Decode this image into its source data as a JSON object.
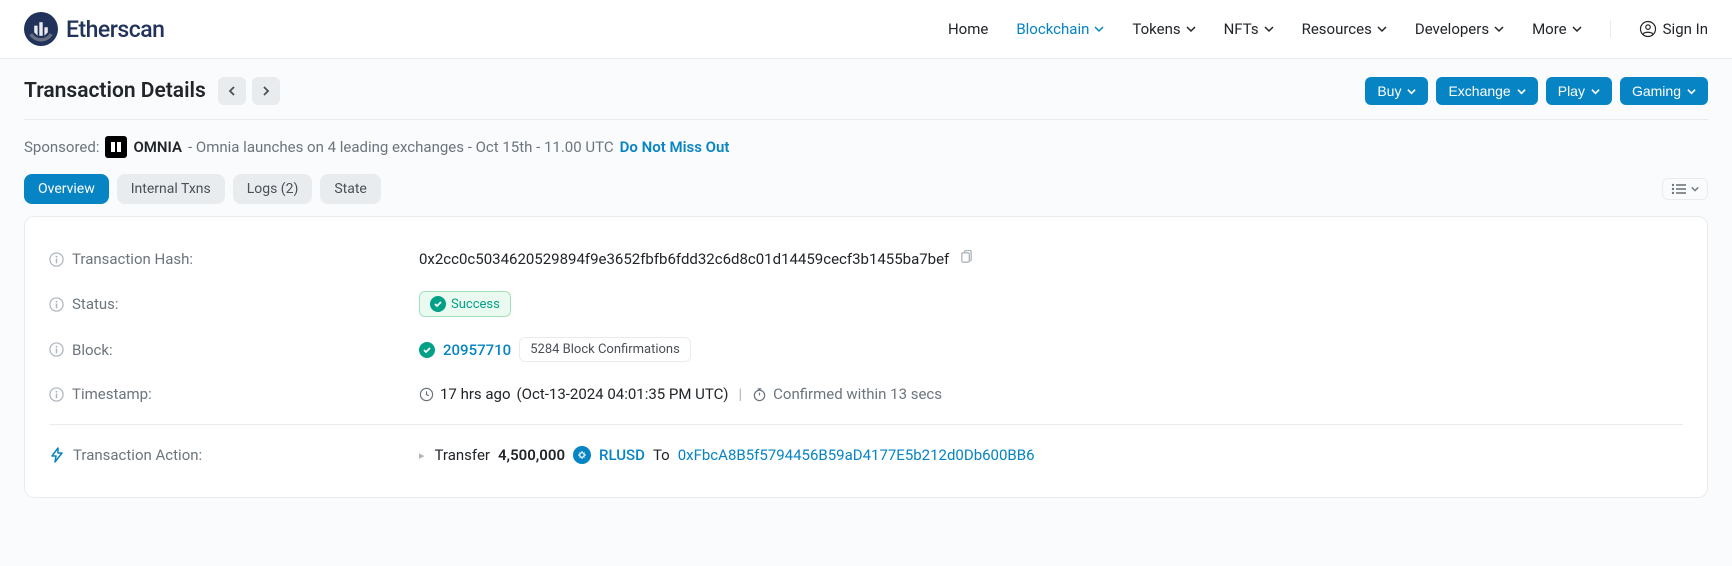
{
  "header": {
    "brand": "Etherscan",
    "nav": [
      {
        "label": "Home",
        "dropdown": false,
        "active": false
      },
      {
        "label": "Blockchain",
        "dropdown": true,
        "active": true
      },
      {
        "label": "Tokens",
        "dropdown": true,
        "active": false
      },
      {
        "label": "NFTs",
        "dropdown": true,
        "active": false
      },
      {
        "label": "Resources",
        "dropdown": true,
        "active": false
      },
      {
        "label": "Developers",
        "dropdown": true,
        "active": false
      },
      {
        "label": "More",
        "dropdown": true,
        "active": false
      }
    ],
    "signin": "Sign In"
  },
  "title": {
    "text": "Transaction Details",
    "cta": [
      {
        "label": "Buy"
      },
      {
        "label": "Exchange"
      },
      {
        "label": "Play"
      },
      {
        "label": "Gaming"
      }
    ]
  },
  "sponsored": {
    "prefix": "Sponsored:",
    "name": "OMNIA",
    "text": "- Omnia launches on 4 leading exchanges - Oct 15th - 11.00 UTC",
    "link": "Do Not Miss Out"
  },
  "tabs": [
    {
      "label": "Overview",
      "active": true
    },
    {
      "label": "Internal Txns",
      "active": false
    },
    {
      "label": "Logs (2)",
      "active": false
    },
    {
      "label": "State",
      "active": false
    }
  ],
  "tx": {
    "labels": {
      "hash": "Transaction Hash:",
      "status": "Status:",
      "block": "Block:",
      "timestamp": "Timestamp:",
      "action": "Transaction Action:"
    },
    "hash": "0x2cc0c5034620529894f9e3652fbfb6fdd32c6d8c01d14459cecf3b1455ba7bef",
    "status": "Success",
    "block": "20957710",
    "confirmations": "5284 Block Confirmations",
    "time_ago": "17 hrs ago",
    "time_full": "(Oct-13-2024 04:01:35 PM UTC)",
    "confirmed_in": "Confirmed within 13 secs",
    "action": {
      "verb": "Transfer",
      "amount": "4,500,000",
      "token": "RLUSD",
      "to_label": "To",
      "to_addr": "0xFbcA8B5f5794456B59aD4177E5b212d0Db600BB6"
    }
  }
}
